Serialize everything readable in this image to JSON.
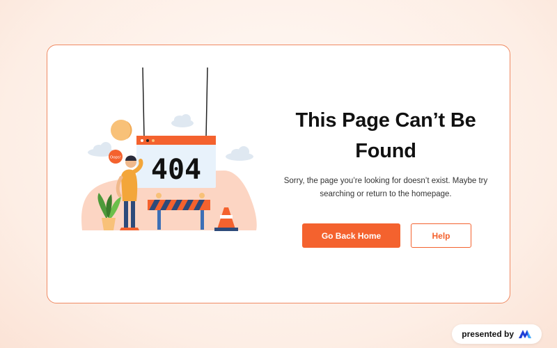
{
  "error_page": {
    "title": "This Page Can’t Be Found",
    "description": "Sorry, the page you’re looking for doesn’t exist. Maybe try searching or return to the homepage.",
    "illustration": {
      "sign_text": "404",
      "bubble_text": "Oops!"
    },
    "primary_button": "Go Back Home",
    "secondary_button": "Help"
  },
  "footer_badge": {
    "label": "presented by",
    "logo_icon": "brand-logo-icon"
  },
  "colors": {
    "accent": "#f4622e",
    "card_border": "#ef8a63",
    "text": "#111111"
  }
}
